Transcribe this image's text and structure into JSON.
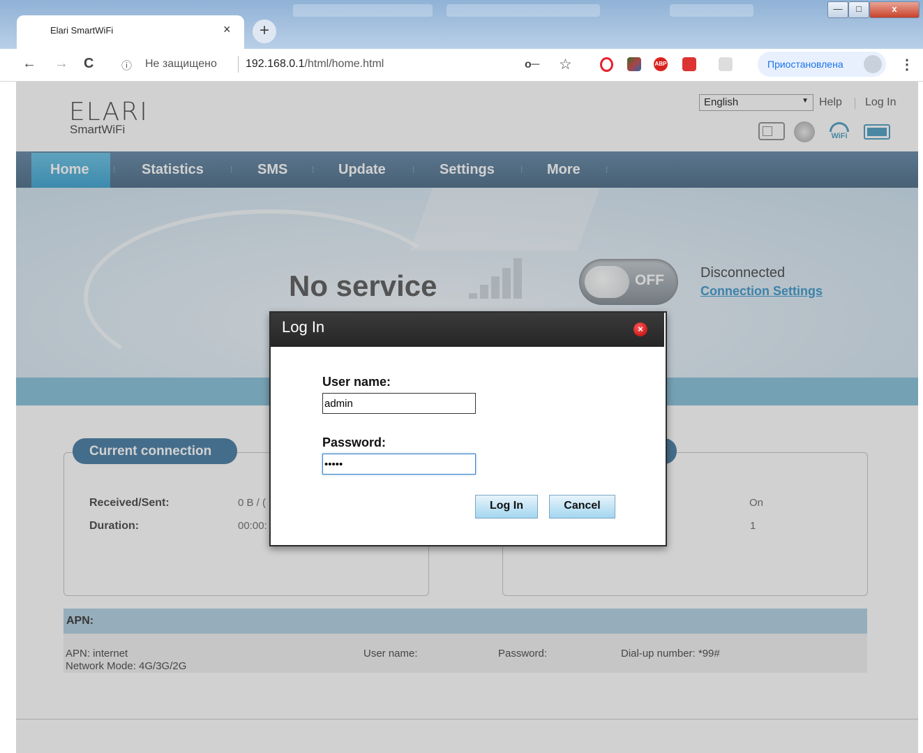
{
  "browser": {
    "tab_title": "Elari SmartWiFi",
    "tab_close": "×",
    "new_tab": "+",
    "window_controls": {
      "minimize": "—",
      "maximize": "□",
      "close": "x"
    },
    "nav": {
      "back": "←",
      "forward": "→",
      "reload": "C"
    },
    "address": {
      "info": "ⓘ",
      "insecure": "Не защищено",
      "host": "192.168.0.1",
      "path": "/html/home.html"
    },
    "profile_status": "Приостановлена",
    "menu": "⋮"
  },
  "header": {
    "logo_main": "ELARI",
    "logo_sub": "SmartWiFi",
    "language": "English",
    "help": "Help",
    "login": "Log In",
    "status_icons": [
      "sim-icon",
      "globe-icon",
      "wifi-icon",
      "battery-icon"
    ],
    "wifi_label": "WiFi"
  },
  "nav": [
    "Home",
    "Statistics",
    "SMS",
    "Update",
    "Settings",
    "More"
  ],
  "banner": {
    "network": "No service",
    "toggle": "OFF",
    "status": "Disconnected",
    "settings_link": "Connection Settings"
  },
  "current_connection": {
    "title": "Current connection",
    "received_sent_label": "Received/Sent:",
    "received_sent_value": "0 B / (",
    "duration_label": "Duration:",
    "duration_value": "00:00:"
  },
  "right_card": {
    "value1": "On",
    "value2": "1"
  },
  "apn": {
    "title": "APN:",
    "apn": "APN: internet",
    "network_mode": "Network Mode: 4G/3G/2G",
    "user_name": "User name:",
    "password": "Password:",
    "dialup": "Dial-up number: *99#"
  },
  "dialog": {
    "title": "Log In",
    "close": "×",
    "user_label": "User name:",
    "user_value": "admin",
    "pass_label": "Password:",
    "pass_value": "•••••",
    "login_btn": "Log In",
    "cancel_btn": "Cancel"
  }
}
